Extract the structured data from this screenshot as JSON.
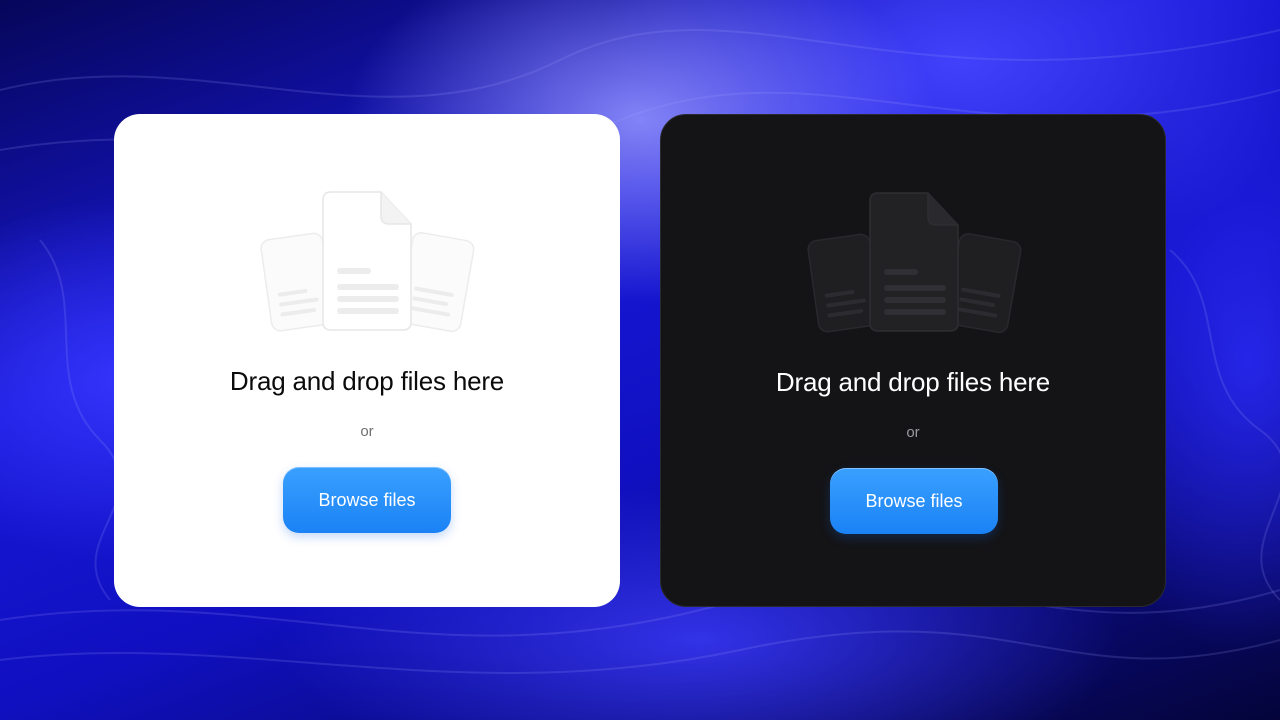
{
  "panels": [
    {
      "theme": "light",
      "title": "Drag and drop files here",
      "separator": "or",
      "button_label": "Browse files",
      "icon": "stacked-documents-icon"
    },
    {
      "theme": "dark",
      "title": "Drag and drop files here",
      "separator": "or",
      "button_label": "Browse files",
      "icon": "stacked-documents-icon"
    }
  ],
  "colors": {
    "accent": "#1E88FF",
    "light_card": "#FFFFFF",
    "dark_card": "#141416",
    "background": "#1414D8"
  }
}
